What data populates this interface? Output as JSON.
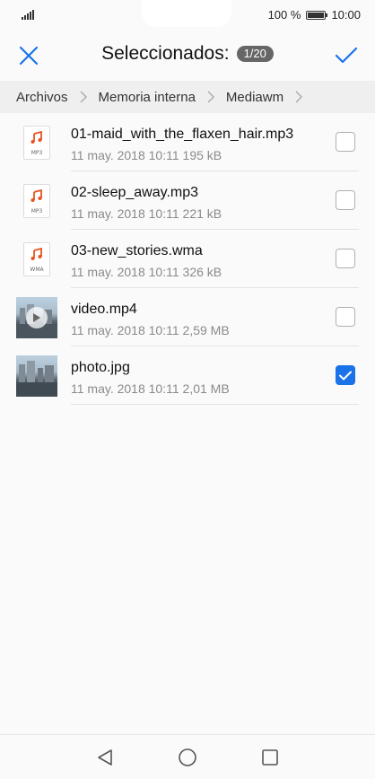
{
  "status_bar": {
    "battery_text": "100 %",
    "time": "10:00"
  },
  "header": {
    "title": "Seleccionados:",
    "count": "1/20",
    "accent_color": "#1a73e8"
  },
  "breadcrumb": {
    "items": [
      "Archivos",
      "Memoria interna",
      "Mediawm"
    ]
  },
  "files": [
    {
      "name": "01-maid_with_the_flaxen_hair.mp3",
      "meta": "11 may. 2018 10:11 195 kB",
      "icon": "music-file-icon",
      "type_label": "MP3",
      "checked": false
    },
    {
      "name": "02-sleep_away.mp3",
      "meta": "11 may. 2018 10:11 221 kB",
      "icon": "music-file-icon",
      "type_label": "MP3",
      "checked": false
    },
    {
      "name": "03-new_stories.wma",
      "meta": "11 may. 2018 10:11 326 kB",
      "icon": "music-file-icon",
      "type_label": "WMA",
      "checked": false
    },
    {
      "name": "video.mp4",
      "meta": "11 may. 2018 10:11 2,59 MB",
      "icon": "video-thumbnail",
      "checked": false
    },
    {
      "name": "photo.jpg",
      "meta": "11 may. 2018 10:11 2,01 MB",
      "icon": "photo-thumbnail",
      "checked": true
    }
  ],
  "nav": {
    "icons": [
      "back-icon",
      "home-icon",
      "recents-icon"
    ]
  }
}
